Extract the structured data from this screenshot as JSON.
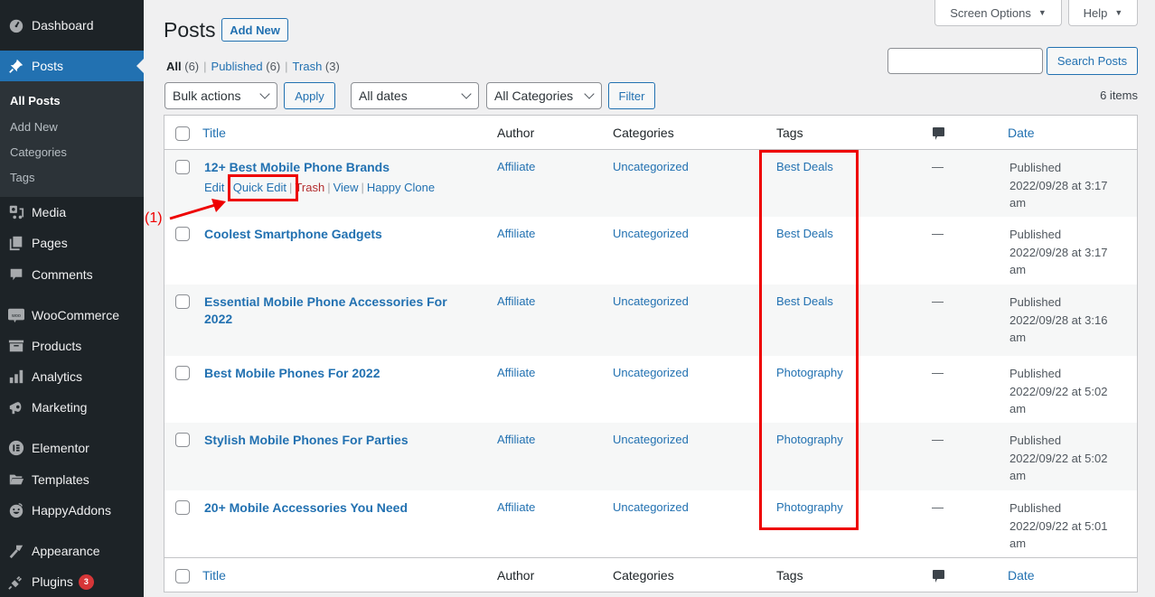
{
  "sidebar": {
    "items": [
      {
        "label": "Dashboard",
        "icon": "dashboard-icon"
      },
      {
        "label": "Posts",
        "icon": "pushpin-icon",
        "active": true
      },
      {
        "label": "Media",
        "icon": "media-icon"
      },
      {
        "label": "Pages",
        "icon": "pages-icon"
      },
      {
        "label": "Comments",
        "icon": "comment-icon"
      },
      {
        "label": "WooCommerce",
        "icon": "woo-icon"
      },
      {
        "label": "Products",
        "icon": "archive-box-icon"
      },
      {
        "label": "Analytics",
        "icon": "bar-chart-icon"
      },
      {
        "label": "Marketing",
        "icon": "megaphone-icon"
      },
      {
        "label": "Elementor",
        "icon": "elementor-icon"
      },
      {
        "label": "Templates",
        "icon": "folder-icon"
      },
      {
        "label": "HappyAddons",
        "icon": "happy-face-icon"
      },
      {
        "label": "Appearance",
        "icon": "paintbrush-icon"
      },
      {
        "label": "Plugins",
        "icon": "plug-icon",
        "badge": "3"
      }
    ],
    "submenu": [
      "All Posts",
      "Add New",
      "Categories",
      "Tags"
    ]
  },
  "top": {
    "screen_options": "Screen Options",
    "help": "Help"
  },
  "header": {
    "title": "Posts",
    "add_new": "Add New"
  },
  "views": {
    "all": "All",
    "all_count": "(6)",
    "published": "Published",
    "published_count": "(6)",
    "trash": "Trash",
    "trash_count": "(3)"
  },
  "filters": {
    "bulk_actions": "Bulk actions",
    "apply": "Apply",
    "dates": "All dates",
    "categories": "All Categories",
    "filter": "Filter",
    "search_value": "",
    "search_button": "Search Posts",
    "items_count": "6 items"
  },
  "table": {
    "columns": {
      "title": "Title",
      "author": "Author",
      "categories": "Categories",
      "tags": "Tags",
      "comments_icon": "comment-bubble-icon",
      "date": "Date"
    },
    "row_actions": {
      "edit": "Edit",
      "quick_edit": "Quick Edit",
      "trash": "Trash",
      "view": "View",
      "happy_clone": "Happy Clone"
    },
    "rows": [
      {
        "title": "12+ Best Mobile Phone Brands",
        "author": "Affiliate",
        "category": "Uncategorized",
        "tag": "Best Deals",
        "comments": "—",
        "status": "Published",
        "date": "2022/09/28 at 3:17",
        "ampm": "am"
      },
      {
        "title": "Coolest Smartphone Gadgets",
        "author": "Affiliate",
        "category": "Uncategorized",
        "tag": "Best Deals",
        "comments": "—",
        "status": "Published",
        "date": "2022/09/28 at 3:17",
        "ampm": "am"
      },
      {
        "title": "Essential Mobile Phone Accessories For 2022",
        "author": "Affiliate",
        "category": "Uncategorized",
        "tag": "Best Deals",
        "comments": "—",
        "status": "Published",
        "date": "2022/09/28 at 3:16",
        "ampm": "am"
      },
      {
        "title": "Best Mobile Phones For 2022",
        "author": "Affiliate",
        "category": "Uncategorized",
        "tag": "Photography",
        "comments": "—",
        "status": "Published",
        "date": "2022/09/22 at 5:02",
        "ampm": "am"
      },
      {
        "title": "Stylish Mobile Phones For Parties",
        "author": "Affiliate",
        "category": "Uncategorized",
        "tag": "Photography",
        "comments": "—",
        "status": "Published",
        "date": "2022/09/22 at 5:02",
        "ampm": "am"
      },
      {
        "title": "20+ Mobile Accessories You Need",
        "author": "Affiliate",
        "category": "Uncategorized",
        "tag": "Photography",
        "comments": "—",
        "status": "Published",
        "date": "2022/09/22 at 5:01",
        "ampm": "am"
      }
    ]
  },
  "annotation": {
    "label": "(1)",
    "color": "#ee0000"
  }
}
